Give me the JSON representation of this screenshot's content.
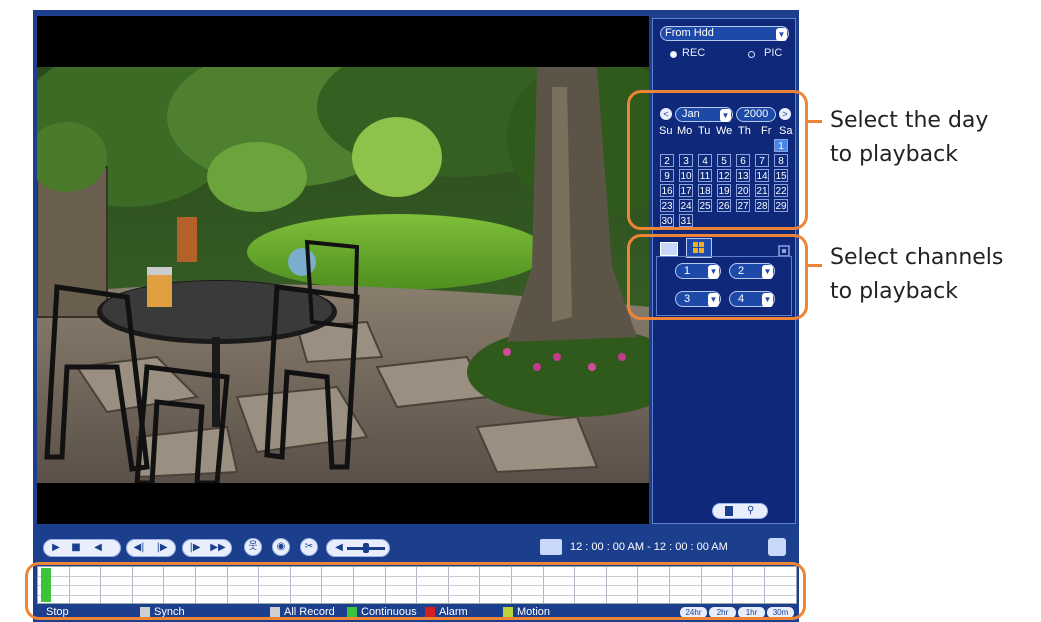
{
  "source": {
    "selected": "From Hdd",
    "rec_label": "REC",
    "pic_label": "PIC"
  },
  "calendar": {
    "month": "Jan",
    "year": "2000",
    "prev": "<",
    "next": ">",
    "weekdays": [
      "Su",
      "Mo",
      "Tu",
      "We",
      "Th",
      "Fr",
      "Sa"
    ],
    "days": [
      "1",
      "2",
      "3",
      "4",
      "5",
      "6",
      "7",
      "8",
      "9",
      "10",
      "11",
      "12",
      "13",
      "14",
      "15",
      "16",
      "17",
      "18",
      "19",
      "20",
      "21",
      "22",
      "23",
      "24",
      "25",
      "26",
      "27",
      "28",
      "29",
      "30",
      "31"
    ],
    "selected_day": "1"
  },
  "channels": {
    "ch1": "1",
    "ch2": "2",
    "ch3": "3",
    "ch4": "4"
  },
  "time": {
    "start": "12 : 00 : 00 AM",
    "separator": "-",
    "end": "12 : 00 : 00 AM"
  },
  "status": {
    "state": "Stop",
    "synch": "Synch",
    "all_record": "All Record",
    "continuous": "Continuous",
    "alarm": "Alarm",
    "motion": "Motion"
  },
  "zoom": [
    "24hr",
    "2hr",
    "1hr",
    "30m"
  ],
  "callouts": {
    "day": [
      "Select the day",
      "to playback"
    ],
    "channels": [
      "Select channels",
      "to playback"
    ]
  },
  "colors": {
    "accent": "#ee8438",
    "panel": "#10287a",
    "frame": "#1b3f8c",
    "continuous": "#3cc33c",
    "alarm": "#d62020",
    "motion": "#b8d43a"
  }
}
